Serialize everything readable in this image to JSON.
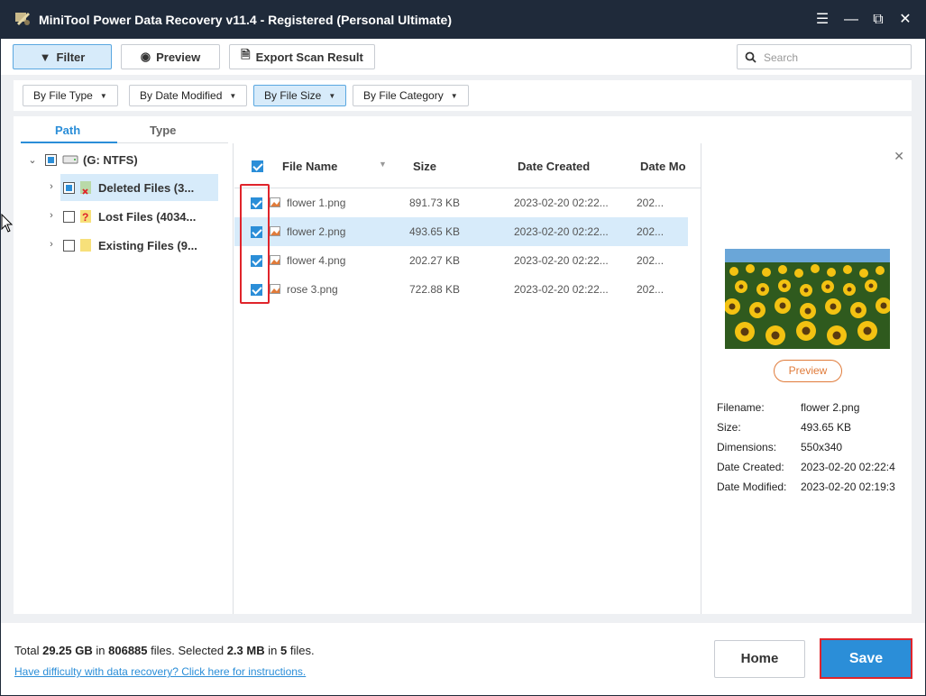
{
  "window": {
    "title": "MiniTool Power Data Recovery v11.4 - Registered (Personal Ultimate)"
  },
  "toolbar": {
    "filter_label": "Filter",
    "preview_label": "Preview",
    "export_label": "Export Scan Result",
    "search_placeholder": "Search"
  },
  "filters": [
    {
      "label": "By File Type",
      "active": false
    },
    {
      "label": "By Date Modified",
      "active": false
    },
    {
      "label": "By File Size",
      "active": true
    },
    {
      "label": "By File Category",
      "active": false
    }
  ],
  "left_panel": {
    "tabs": [
      "Path",
      "Type"
    ],
    "selected_tab": "Path",
    "tree": [
      {
        "label": "(G: NTFS)",
        "state": "partial",
        "expanded": true,
        "icon": "drive-icon"
      },
      {
        "label": "Deleted Files (3...",
        "state": "partial",
        "expanded": false,
        "icon": "deleted-folder-icon"
      },
      {
        "label": "Lost Files (4034...",
        "state": "unchecked",
        "expanded": false,
        "icon": "lost-folder-icon"
      },
      {
        "label": "Existing Files (9...",
        "state": "unchecked",
        "expanded": false,
        "icon": "folder-icon"
      }
    ]
  },
  "file_table": {
    "headers": [
      "File Name",
      "Size",
      "Date Created",
      "Date Mo"
    ],
    "rows": [
      {
        "name": "flower 1.png",
        "size": "891.73 KB",
        "created": "2023-02-20 02:22...",
        "modified": "202...",
        "checked": true
      },
      {
        "name": "flower 2.png",
        "size": "493.65 KB",
        "created": "2023-02-20 02:22...",
        "modified": "202...",
        "checked": true
      },
      {
        "name": "flower 4.png",
        "size": "202.27 KB",
        "created": "2023-02-20 02:22...",
        "modified": "202...",
        "checked": true
      },
      {
        "name": "rose 3.png",
        "size": "722.88 KB",
        "created": "2023-02-20 02:22...",
        "modified": "202...",
        "checked": true
      }
    ],
    "selected_row": 1
  },
  "preview_panel": {
    "preview_button": "Preview",
    "info": [
      {
        "label": "Filename:",
        "value": "flower 2.png"
      },
      {
        "label": "Size:",
        "value": "493.65 KB"
      },
      {
        "label": "Dimensions:",
        "value": "550x340"
      },
      {
        "label": "Date Created:",
        "value": "2023-02-20 02:22:4"
      },
      {
        "label": "Date Modified:",
        "value": "2023-02-20 02:19:3"
      }
    ]
  },
  "footer": {
    "total_prefix": "Total",
    "total_size": "29.25 GB",
    "in1": "in",
    "total_files": "806885",
    "files_selected_text": "files. Selected",
    "selected_size": "2.3 MB",
    "in2": "in",
    "selected_count": "5",
    "files_suffix": "files.",
    "help_link": "Have difficulty with data recovery? Click here for instructions.",
    "home_label": "Home",
    "save_label": "Save"
  },
  "colors": {
    "titlebar": "#1f2a3a",
    "accent": "#2b8ed8",
    "highlight": "#d7ebfa",
    "annotation_red": "#e0242b",
    "preview_orange": "#e07b3a"
  }
}
